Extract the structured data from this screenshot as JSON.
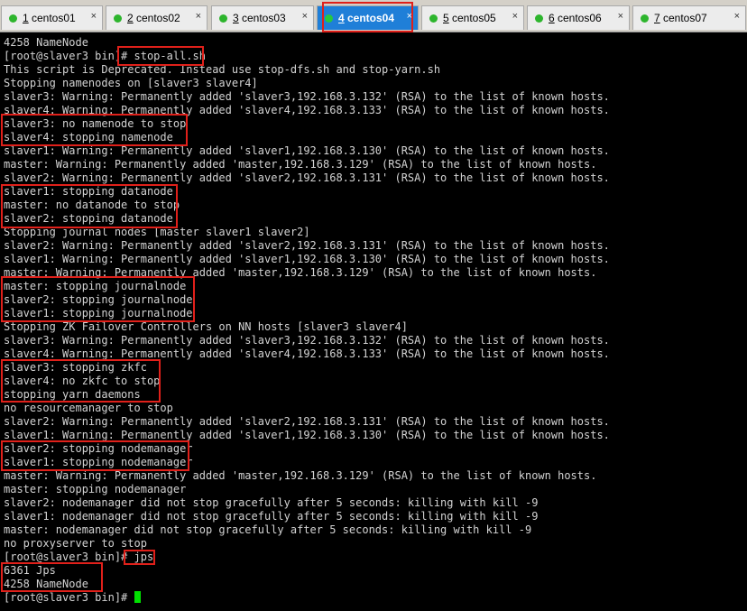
{
  "tabs": [
    {
      "num": "1",
      "name": "centos01",
      "active": false
    },
    {
      "num": "2",
      "name": "centos02",
      "active": false
    },
    {
      "num": "3",
      "name": "centos03",
      "active": false
    },
    {
      "num": "4",
      "name": "centos04",
      "active": true
    },
    {
      "num": "5",
      "name": "centos05",
      "active": false
    },
    {
      "num": "6",
      "name": "centos06",
      "active": false
    },
    {
      "num": "7",
      "name": "centos07",
      "active": false
    }
  ],
  "colors": {
    "highlight_box": "#e0201a",
    "active_tab": "#1f7fd8",
    "status_dot": "#2db52d",
    "cursor": "#00e000"
  },
  "icons": {
    "tab_close": "×",
    "status": "green-dot-icon"
  },
  "terminal": {
    "lines": [
      "4258 NameNode",
      "[root@slaver3 bin]# stop-all.sh",
      "This script is Deprecated. Instead use stop-dfs.sh and stop-yarn.sh",
      "Stopping namenodes on [slaver3 slaver4]",
      "slaver3: Warning: Permanently added 'slaver3,192.168.3.132' (RSA) to the list of known hosts.",
      "slaver4: Warning: Permanently added 'slaver4,192.168.3.133' (RSA) to the list of known hosts.",
      "slaver3: no namenode to stop",
      "slaver4: stopping namenode",
      "slaver1: Warning: Permanently added 'slaver1,192.168.3.130' (RSA) to the list of known hosts.",
      "master: Warning: Permanently added 'master,192.168.3.129' (RSA) to the list of known hosts.",
      "slaver2: Warning: Permanently added 'slaver2,192.168.3.131' (RSA) to the list of known hosts.",
      "slaver1: stopping datanode",
      "master: no datanode to stop",
      "slaver2: stopping datanode",
      "Stopping journal nodes [master slaver1 slaver2]",
      "slaver2: Warning: Permanently added 'slaver2,192.168.3.131' (RSA) to the list of known hosts.",
      "slaver1: Warning: Permanently added 'slaver1,192.168.3.130' (RSA) to the list of known hosts.",
      "master: Warning: Permanently added 'master,192.168.3.129' (RSA) to the list of known hosts.",
      "master: stopping journalnode",
      "slaver2: stopping journalnode",
      "slaver1: stopping journalnode",
      "Stopping ZK Failover Controllers on NN hosts [slaver3 slaver4]",
      "slaver3: Warning: Permanently added 'slaver3,192.168.3.132' (RSA) to the list of known hosts.",
      "slaver4: Warning: Permanently added 'slaver4,192.168.3.133' (RSA) to the list of known hosts.",
      "slaver3: stopping zkfc",
      "slaver4: no zkfc to stop",
      "stopping yarn daemons",
      "no resourcemanager to stop",
      "slaver2: Warning: Permanently added 'slaver2,192.168.3.131' (RSA) to the list of known hosts.",
      "slaver1: Warning: Permanently added 'slaver1,192.168.3.130' (RSA) to the list of known hosts.",
      "slaver2: stopping nodemanager",
      "slaver1: stopping nodemanager",
      "master: Warning: Permanently added 'master,192.168.3.129' (RSA) to the list of known hosts.",
      "master: stopping nodemanager",
      "slaver2: nodemanager did not stop gracefully after 5 seconds: killing with kill -9",
      "slaver1: nodemanager did not stop gracefully after 5 seconds: killing with kill -9",
      "master: nodemanager did not stop gracefully after 5 seconds: killing with kill -9",
      "no proxyserver to stop",
      "[root@slaver3 bin]# jps",
      "6361 Jps",
      "4258 NameNode",
      "[root@slaver3 bin]# "
    ]
  }
}
